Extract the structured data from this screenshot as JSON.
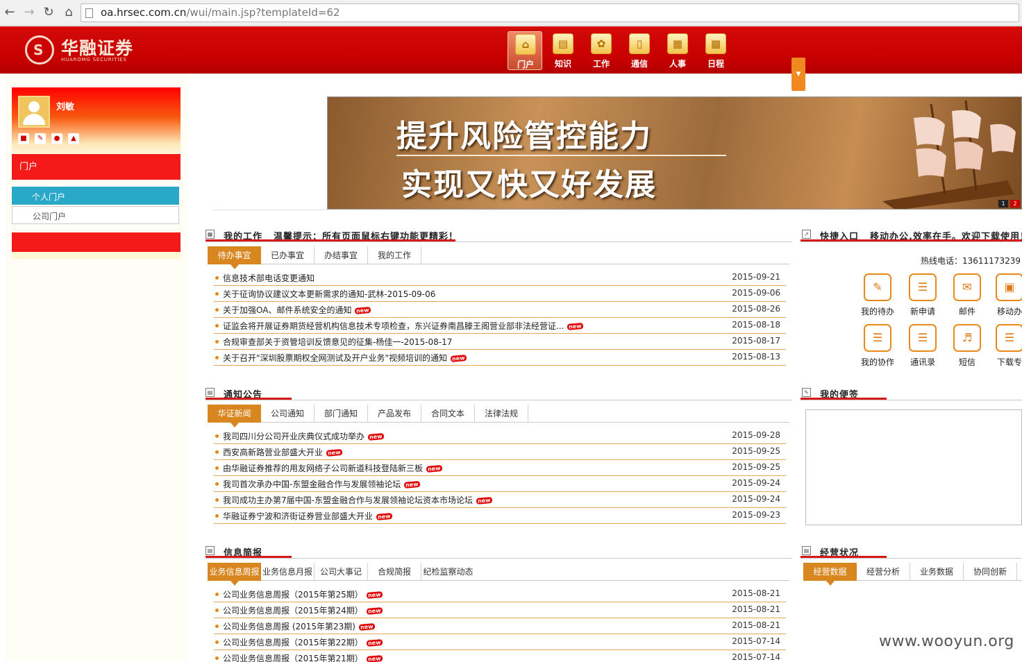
{
  "browser": {
    "url_host": "oa.hrsec.com.cn",
    "url_path": "/wui/main.jsp?templateId=62"
  },
  "header": {
    "logo_cn": "华融证券",
    "logo_en": "HUAROMG SECURITIES",
    "nav": [
      {
        "label": "门户",
        "icon": "home-icon"
      },
      {
        "label": "知识",
        "icon": "book-icon"
      },
      {
        "label": "工作",
        "icon": "work-icon"
      },
      {
        "label": "通信",
        "icon": "phone-icon"
      },
      {
        "label": "人事",
        "icon": "document-icon"
      },
      {
        "label": "日程",
        "icon": "calendar-icon"
      }
    ]
  },
  "sidebar": {
    "user_name": "刘敏",
    "section": "门户",
    "items": [
      "个人门户",
      "公司门户"
    ]
  },
  "banner": {
    "line1": "提升风险管控能力",
    "line2": "实现又快又好发展",
    "dots": [
      "1",
      "2"
    ]
  },
  "work": {
    "title": "我的工作",
    "tip": "温馨提示：所有页面鼠标右键功能更精彩！",
    "tabs": [
      "待办事宜",
      "已办事宜",
      "办结事宜",
      "我的工作"
    ],
    "items": [
      {
        "title": "信息技术部电话变更通知",
        "date": "2015-09-21",
        "new": false
      },
      {
        "title": "关于征询协议建议文本更新需求的通知-武林-2015-09-06",
        "date": "2015-09-06",
        "new": false
      },
      {
        "title": "关于加强OA、邮件系统安全的通知",
        "date": "2015-08-26",
        "new": true
      },
      {
        "title": "证监会将开展证券期货经营机构信息技术专项检查，东兴证券南昌滕王阁营业部非法经营证...",
        "date": "2015-08-18",
        "new": true
      },
      {
        "title": "合规审查部关于资管培训反馈意见的征集-杨佳一-2015-08-17",
        "date": "2015-08-17",
        "new": false
      },
      {
        "title": "关于召开\"深圳股票期权全网测试及开户业务\"视频培训的通知",
        "date": "2015-08-13",
        "new": true
      }
    ]
  },
  "notice": {
    "title": "通知公告",
    "tabs": [
      "华证新闻",
      "公司通知",
      "部门通知",
      "产品发布",
      "合同文本",
      "法律法规"
    ],
    "items": [
      {
        "title": "我司四川分公司开业庆典仪式成功举办",
        "date": "2015-09-28",
        "new": true
      },
      {
        "title": "西安高新路营业部盛大开业",
        "date": "2015-09-25",
        "new": true
      },
      {
        "title": "由华融证券推荐的用友网络子公司新道科技登陆新三板",
        "date": "2015-09-25",
        "new": true
      },
      {
        "title": "我司首次承办中国-东盟金融合作与发展领袖论坛",
        "date": "2015-09-24",
        "new": true
      },
      {
        "title": "我司成功主办第7届中国-东盟金融合作与发展领袖论坛资本市场论坛",
        "date": "2015-09-24",
        "new": true
      },
      {
        "title": "华融证券宁波和济街证券营业部盛大开业",
        "date": "2015-09-23",
        "new": true
      }
    ]
  },
  "briefing": {
    "title": "信息简报",
    "tabs": [
      "业务信息周报",
      "业务信息月报",
      "公司大事记",
      "合规简报",
      "纪检监察动态"
    ],
    "items": [
      {
        "title": "公司业务信息周报（2015年第25期）",
        "date": "2015-08-21",
        "new": true
      },
      {
        "title": "公司业务信息周报（2015年第24期）",
        "date": "2015-08-21",
        "new": true
      },
      {
        "title": "公司业务信息周报 (2015年第23期)",
        "date": "2015-08-21",
        "new": true
      },
      {
        "title": "公司业务信息周报（2015年第22期）",
        "date": "2015-07-14",
        "new": true
      },
      {
        "title": "公司业务信息周报（2015年第21期）",
        "date": "2015-07-14",
        "new": true
      }
    ]
  },
  "quick": {
    "title": "快捷入口",
    "tip": "移动办公,效率在手。欢迎下载使用！",
    "hotline": "热线电话：13611173239",
    "items": [
      {
        "label": "我的待办",
        "icon": "pencil-icon"
      },
      {
        "label": "新申请",
        "icon": "form-icon"
      },
      {
        "label": "邮件",
        "icon": "mail-icon"
      },
      {
        "label": "移动办",
        "icon": "mobile-office-icon"
      },
      {
        "label": "我的协作",
        "icon": "collaboration-icon"
      },
      {
        "label": "通讯录",
        "icon": "contacts-icon"
      },
      {
        "label": "短信",
        "icon": "sms-icon"
      },
      {
        "label": "下载专",
        "icon": "download-icon"
      }
    ]
  },
  "memo": {
    "title": "我的便签"
  },
  "business": {
    "title": "经营状况",
    "tabs": [
      "经营数据",
      "经营分析",
      "业务数据",
      "协同创新"
    ]
  },
  "new_badge": "new",
  "watermark": "www.wooyun.org"
}
